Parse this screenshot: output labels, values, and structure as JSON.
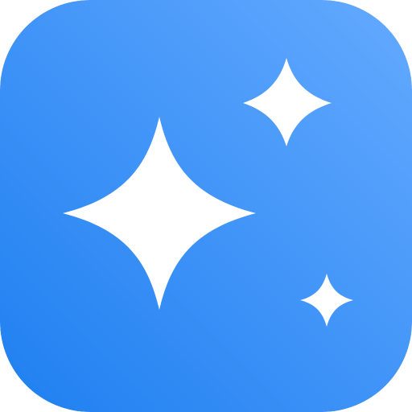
{
  "icon": {
    "name": "sparkles-app-icon",
    "glyph": "sparkles-icon",
    "colors": {
      "gradient_start": "#1e7ff0",
      "gradient_end": "#64aaff",
      "sparkle": "#ffffff"
    }
  }
}
